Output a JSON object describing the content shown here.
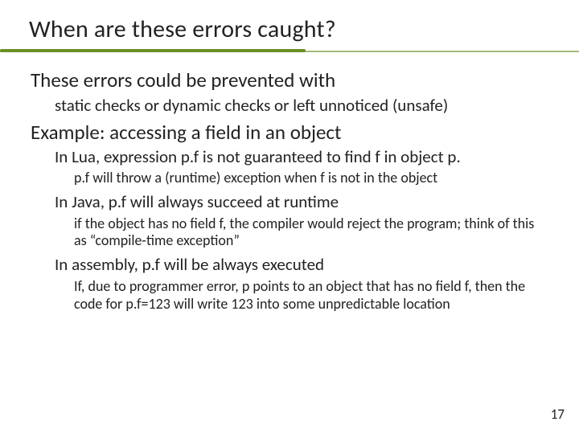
{
  "title": "When are these errors caught?",
  "b1": "These errors could be prevented with",
  "b1a": "static checks or dynamic checks or left unnoticed (unsafe)",
  "b2": "Example: accessing a field in an object",
  "b2a": "In Lua, expression p.f is not guaranteed to find f in object p.",
  "b2a1": "p.f will throw a (runtime) exception when f is not in the object",
  "b2b": "In Java, p.f will always succeed at runtime",
  "b2b1": "if the object has no field f, the compiler would reject the program; think of this as “compile-time exception”",
  "b2c": "In assembly, p.f will be always executed",
  "b2c1": "If, due to programmer error, p points to an object that has no field f, then the code for p.f=123 will write 123 into some unpredictable location",
  "pagenum": "17"
}
